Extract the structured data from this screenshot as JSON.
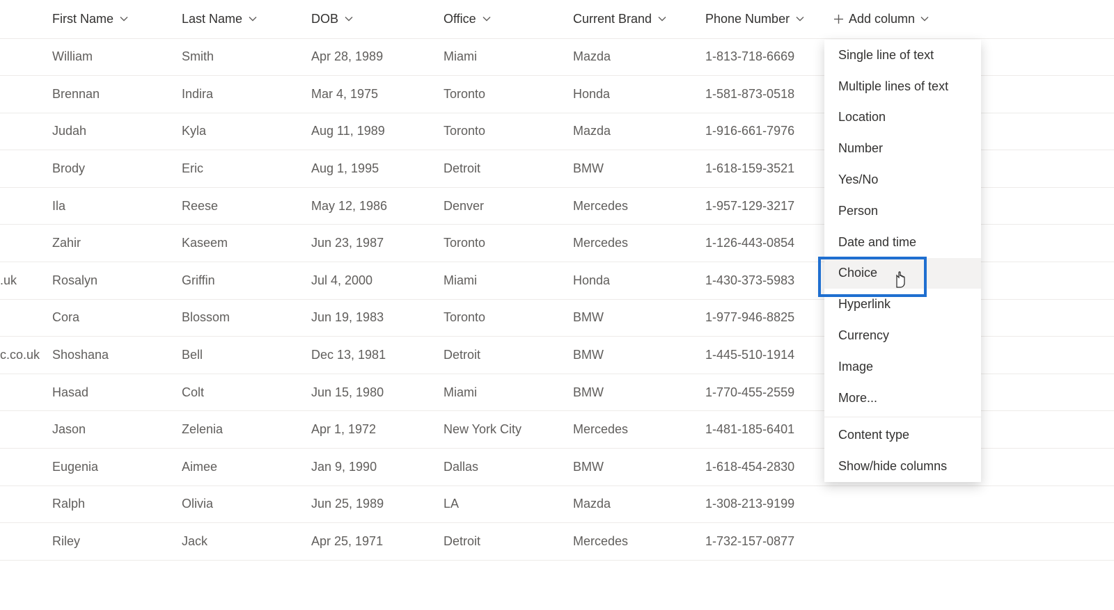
{
  "columns": {
    "first_name": "First Name",
    "last_name": "Last Name",
    "dob": "DOB",
    "office": "Office",
    "brand": "Current Brand",
    "phone": "Phone Number",
    "add": "Add column"
  },
  "rows": [
    {
      "lead": "",
      "first": "William",
      "last": "Smith",
      "dob": "Apr 28, 1989",
      "office": "Miami",
      "brand": "Mazda",
      "phone": "1-813-718-6669"
    },
    {
      "lead": "",
      "first": "Brennan",
      "last": "Indira",
      "dob": "Mar 4, 1975",
      "office": "Toronto",
      "brand": "Honda",
      "phone": "1-581-873-0518"
    },
    {
      "lead": "",
      "first": "Judah",
      "last": "Kyla",
      "dob": "Aug 11, 1989",
      "office": "Toronto",
      "brand": "Mazda",
      "phone": "1-916-661-7976"
    },
    {
      "lead": "",
      "first": "Brody",
      "last": "Eric",
      "dob": "Aug 1, 1995",
      "office": "Detroit",
      "brand": "BMW",
      "phone": "1-618-159-3521"
    },
    {
      "lead": "",
      "first": "Ila",
      "last": "Reese",
      "dob": "May 12, 1986",
      "office": "Denver",
      "brand": "Mercedes",
      "phone": "1-957-129-3217"
    },
    {
      "lead": "",
      "first": "Zahir",
      "last": "Kaseem",
      "dob": "Jun 23, 1987",
      "office": "Toronto",
      "brand": "Mercedes",
      "phone": "1-126-443-0854"
    },
    {
      "lead": ".uk",
      "first": "Rosalyn",
      "last": "Griffin",
      "dob": "Jul 4, 2000",
      "office": "Miami",
      "brand": "Honda",
      "phone": "1-430-373-5983"
    },
    {
      "lead": "",
      "first": "Cora",
      "last": "Blossom",
      "dob": "Jun 19, 1983",
      "office": "Toronto",
      "brand": "BMW",
      "phone": "1-977-946-8825"
    },
    {
      "lead": "c.co.uk",
      "first": "Shoshana",
      "last": "Bell",
      "dob": "Dec 13, 1981",
      "office": "Detroit",
      "brand": "BMW",
      "phone": "1-445-510-1914"
    },
    {
      "lead": "",
      "first": "Hasad",
      "last": "Colt",
      "dob": "Jun 15, 1980",
      "office": "Miami",
      "brand": "BMW",
      "phone": "1-770-455-2559"
    },
    {
      "lead": "",
      "first": "Jason",
      "last": "Zelenia",
      "dob": "Apr 1, 1972",
      "office": "New York City",
      "brand": "Mercedes",
      "phone": "1-481-185-6401"
    },
    {
      "lead": "",
      "first": "Eugenia",
      "last": "Aimee",
      "dob": "Jan 9, 1990",
      "office": "Dallas",
      "brand": "BMW",
      "phone": "1-618-454-2830"
    },
    {
      "lead": "",
      "first": "Ralph",
      "last": "Olivia",
      "dob": "Jun 25, 1989",
      "office": "LA",
      "brand": "Mazda",
      "phone": "1-308-213-9199"
    },
    {
      "lead": "",
      "first": "Riley",
      "last": "Jack",
      "dob": "Apr 25, 1971",
      "office": "Detroit",
      "brand": "Mercedes",
      "phone": "1-732-157-0877"
    }
  ],
  "menu": {
    "single": "Single line of text",
    "multi": "Multiple lines of text",
    "location": "Location",
    "number": "Number",
    "yesno": "Yes/No",
    "person": "Person",
    "datetime": "Date and time",
    "choice": "Choice",
    "hyperlink": "Hyperlink",
    "currency": "Currency",
    "image": "Image",
    "more": "More...",
    "content_type": "Content type",
    "showhide": "Show/hide columns"
  }
}
